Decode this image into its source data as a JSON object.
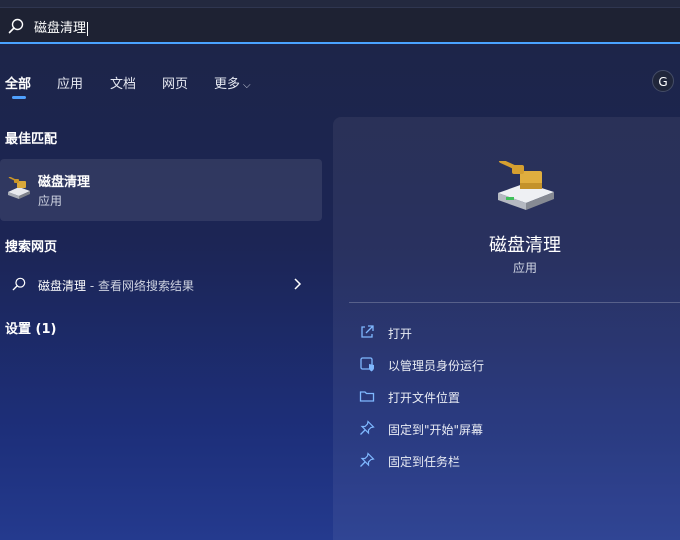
{
  "search": {
    "query": "磁盘清理"
  },
  "tabs": [
    {
      "label": "全部"
    },
    {
      "label": "应用"
    },
    {
      "label": "文档"
    },
    {
      "label": "网页"
    },
    {
      "label": "更多"
    }
  ],
  "avatar": {
    "letter": "G"
  },
  "best_match": {
    "heading": "最佳匹配",
    "name": "磁盘清理",
    "type": "应用"
  },
  "web_search": {
    "heading": "搜索网页",
    "query": "磁盘清理",
    "suffix": " - 查看网络搜索结果"
  },
  "settings": {
    "heading": "设置 (1)"
  },
  "detail": {
    "title": "磁盘清理",
    "type": "应用",
    "actions": [
      {
        "label": "打开",
        "icon": "open-external-icon"
      },
      {
        "label": "以管理员身份运行",
        "icon": "shield-admin-icon"
      },
      {
        "label": "打开文件位置",
        "icon": "folder-icon"
      },
      {
        "label": "固定到\"开始\"屏幕",
        "icon": "pin-icon"
      },
      {
        "label": "固定到任务栏",
        "icon": "pin-icon"
      }
    ]
  },
  "colors": {
    "accent": "#4aa3ff"
  }
}
